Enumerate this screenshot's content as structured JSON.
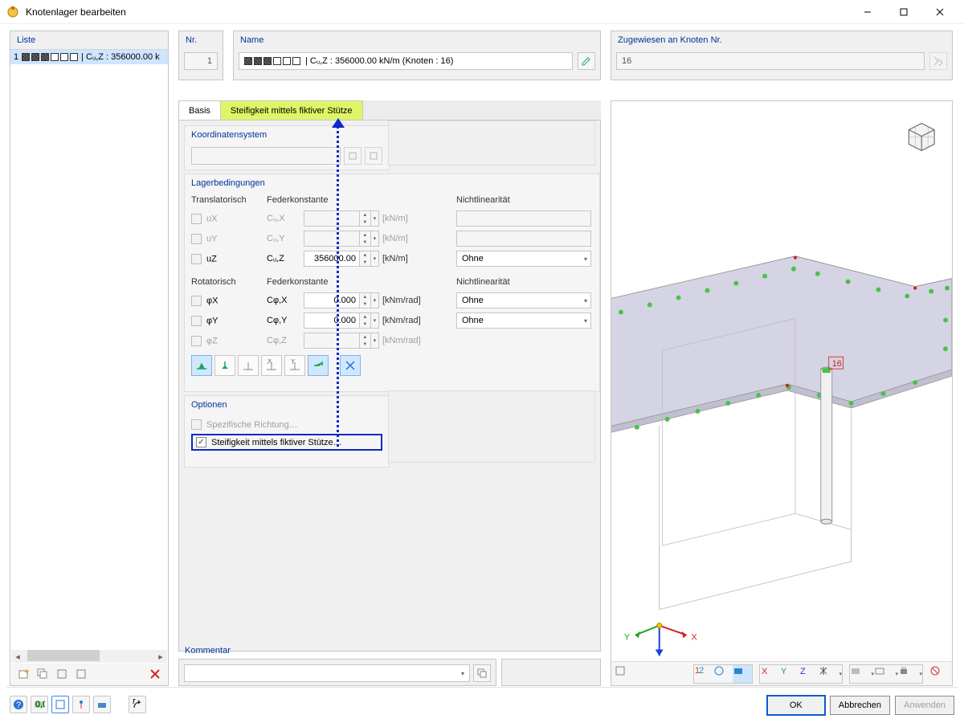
{
  "window": {
    "title": "Knotenlager bearbeiten"
  },
  "list": {
    "header": "Liste",
    "items": [
      {
        "num": "1",
        "text": "| Cᵤ,Z : 356000.00 k"
      }
    ]
  },
  "header": {
    "nr": {
      "label": "Nr.",
      "value": "1"
    },
    "name": {
      "label": "Name",
      "value": "| Cᵤ,Z : 356000.00 kN/m (Knoten : 16)"
    },
    "assigned": {
      "label": "Zugewiesen an Knoten Nr.",
      "value": "16"
    }
  },
  "tabs": {
    "basis": "Basis",
    "stiffness": "Steifigkeit mittels fiktiver Stütze"
  },
  "koord": {
    "title": "Koordinatensystem"
  },
  "support": {
    "title": "Lagerbedingungen",
    "trans_label": "Translatorisch",
    "rot_label": "Rotatorisch",
    "spring_label": "Federkonstante",
    "nonlin_label": "Nichtlinearität",
    "rows": {
      "ux": {
        "label": "uX",
        "const": "Cᵤ,X",
        "value": "",
        "unit": "[kN/m]"
      },
      "uy": {
        "label": "uY",
        "const": "Cᵤ,Y",
        "value": "",
        "unit": "[kN/m]"
      },
      "uz": {
        "label": "uZ",
        "const": "Cᵤ,Z",
        "value": "356000.00",
        "unit": "[kN/m]",
        "nonlin": "Ohne"
      },
      "px": {
        "label": "φX",
        "const": "Cφ,X",
        "value": "0.000",
        "unit": "[kNm/rad]",
        "nonlin": "Ohne"
      },
      "py": {
        "label": "φY",
        "const": "Cφ,Y",
        "value": "0.000",
        "unit": "[kNm/rad]",
        "nonlin": "Ohne"
      },
      "pz": {
        "label": "φZ",
        "const": "Cφ,Z",
        "value": "",
        "unit": "[kNm/rad]"
      }
    }
  },
  "options": {
    "title": "Optionen",
    "specific": "Spezifische Richtung…",
    "stiffness": "Steifigkeit mittels fiktiver Stütze…"
  },
  "comment": {
    "label": "Kommentar"
  },
  "preview": {
    "node_label": "16",
    "axes": {
      "x": "X",
      "y": "Y",
      "z": "Z"
    }
  },
  "buttons": {
    "ok": "OK",
    "cancel": "Abbrechen",
    "apply": "Anwenden"
  }
}
